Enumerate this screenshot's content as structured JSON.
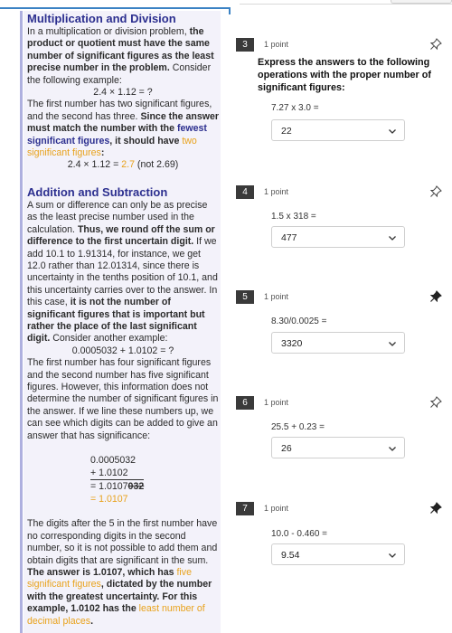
{
  "study_panel": {
    "mult_div": {
      "title": "Multiplication and Division",
      "p1_a": "In a multiplication or division problem, ",
      "p1_b": "the product or quotient must have the same number of significant figures as the least precise number in the problem.",
      "p1_c": " Consider the following example:",
      "example": "2.4 × 1.12 = ?",
      "p2_a": "The first number has two significant figures, and the second has three. ",
      "p2_b": "Since the answer must match the number with the ",
      "p2_c": "fewest significant figures",
      "p2_d": ", it should have ",
      "p2_e": "two significant figures",
      "p2_f": ":",
      "result_a": "2.4 × 1.12 = ",
      "result_b": "2.7",
      "result_c": " (not 2.69)"
    },
    "add_sub": {
      "title": "Addition and Subtraction",
      "p1_a": "A sum or difference can only be as precise as the least precise number used in the calculation. ",
      "p1_b": "Thus, we round off the sum or difference to the first uncertain digit.",
      "p1_c": " If we add 10.1 to 1.91314, for instance, we get 12.0 rather than 12.01314, since there is uncertainty in the tenths position of 10.1, and this uncertainty carries over to the answer. In this case, ",
      "p1_d": "it is not the number of significant figures that is important but rather the place of the last significant digit.",
      "p1_e": " Consider another example:",
      "example": "0.0005032 + 1.0102 = ?",
      "p2_a": "The first number has four significant figures and the second number has five significant figures. However, this information does not determine the number of significant figures in the answer. If we line these numbers up, we can see which digits can be added to give an answer that has significance:",
      "calc_line1": "0.0005032",
      "calc_line2": "+ 1.0102",
      "calc_line3_a": "= 1.0107",
      "calc_line3_b": "032",
      "calc_line4": "= 1.0107",
      "p3_a": "The digits after the 5 in the first number have no corresponding digits in the second number, so it is not possible to add them and obtain digits that are significant in the sum. ",
      "p3_b": "The answer is 1.0107, which has ",
      "p3_c": "five significant figures",
      "p3_d": ", dictated by the number with the greatest uncertainty. For this example, 1.0102 has the ",
      "p3_e": "least number of decimal places",
      "p3_f": "."
    }
  },
  "questions": [
    {
      "number": "3",
      "points": "1 point",
      "instruction": "Express the answers to the following operations with the proper number of significant figures:",
      "expression": "7.27 x 3.0 =",
      "answer": "22",
      "pinned": false
    },
    {
      "number": "4",
      "points": "1 point",
      "expression": "1.5 x 318 =",
      "answer": "477",
      "pinned": false
    },
    {
      "number": "5",
      "points": "1 point",
      "expression": "8.30/0.0025 =",
      "answer": "3320",
      "pinned": true
    },
    {
      "number": "6",
      "points": "1 point",
      "expression": "25.5 + 0.23 =",
      "answer": "26",
      "pinned": false
    },
    {
      "number": "7",
      "points": "1 point",
      "expression": "10.0 - 0.460 =",
      "answer": "9.54",
      "pinned": true
    }
  ],
  "colors": {
    "heading": "#2c2f8f",
    "highlight": "#e8a21c",
    "panel_bg": "#f3f2fa",
    "badge": "#3a3a3a"
  },
  "icons": {
    "pin": "pushpin-icon",
    "chevron": "chevron-down-icon"
  }
}
